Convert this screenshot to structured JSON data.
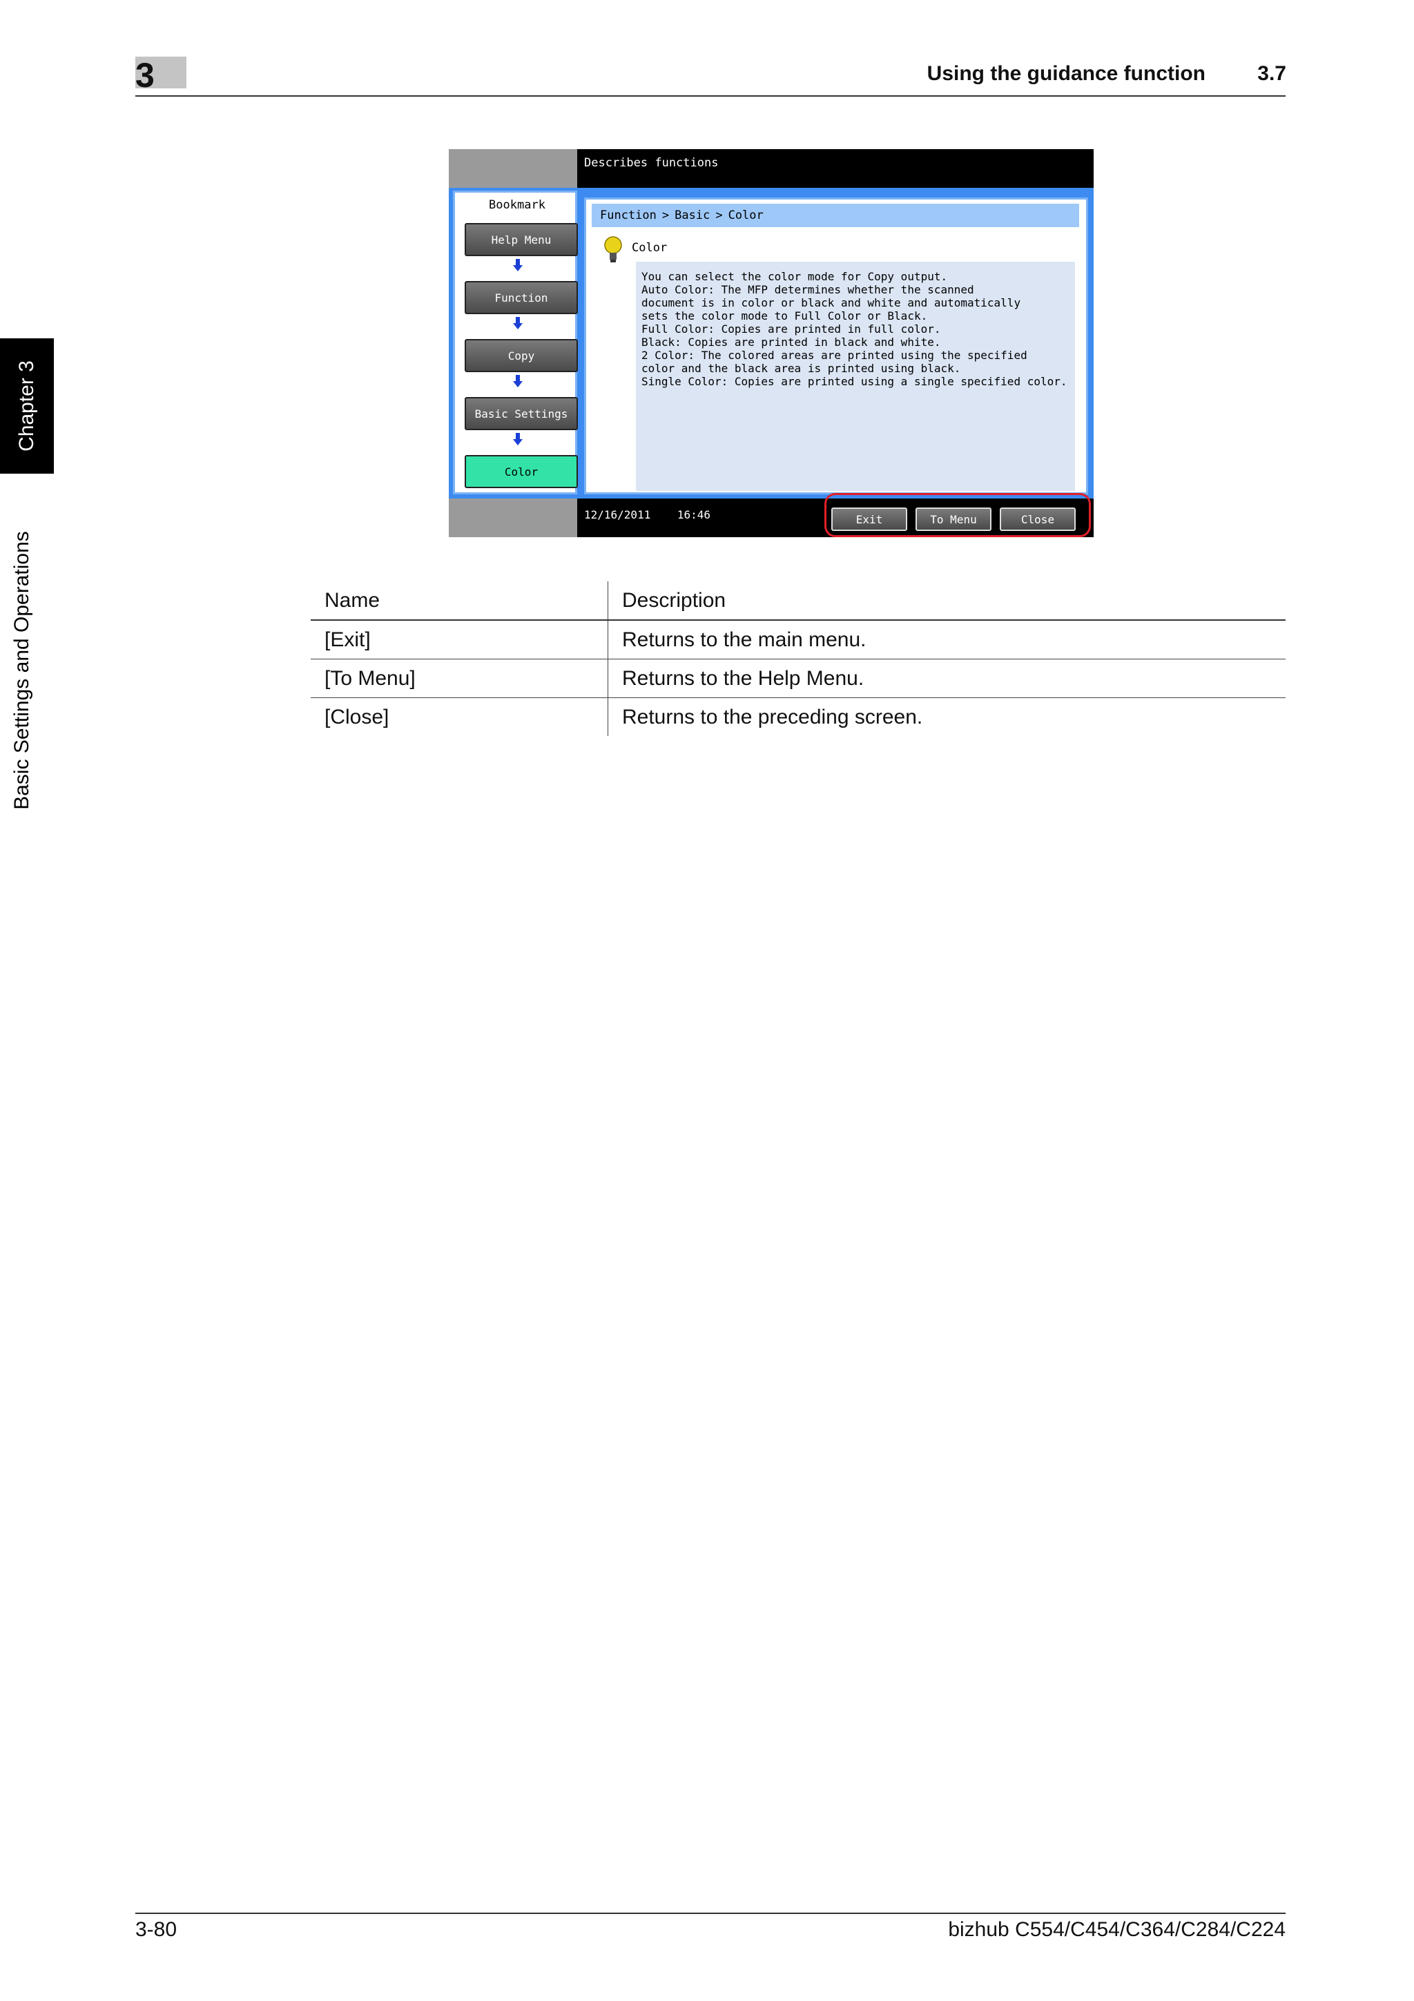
{
  "header": {
    "chapter_number": "3",
    "title": "Using the guidance function",
    "section": "3.7"
  },
  "side": {
    "chapter_tab": "Chapter 3",
    "section_tab": "Basic Settings and Operations"
  },
  "screen": {
    "top_label": "Describes functions",
    "bookmark": {
      "title": "Bookmark",
      "items": [
        "Help Menu",
        "Function",
        "Copy",
        "Basic Settings",
        "Color"
      ]
    },
    "breadcrumb": [
      "Function",
      "Basic",
      "Color"
    ],
    "help_title": "Color",
    "description": "You can select the color mode for Copy output.\nAuto Color: The MFP determines whether the scanned\ndocument is in color or black and white and automatically\nsets the color mode to Full Color or Black.\nFull Color: Copies are printed in full color.\nBlack: Copies are printed in black and white.\n2 Color: The colored areas are printed using the specified\ncolor and the black area is printed using black.\nSingle Color: Copies are printed using a single specified color.",
    "date": "12/16/2011",
    "time": "16:46",
    "buttons": [
      "Exit",
      "To Menu",
      "Close"
    ]
  },
  "table": {
    "headers": [
      "Name",
      "Description"
    ],
    "rows": [
      [
        "[Exit]",
        "Returns to the main menu."
      ],
      [
        "[To Menu]",
        "Returns to the Help Menu."
      ],
      [
        "[Close]",
        "Returns to the preceding screen."
      ]
    ]
  },
  "footer": {
    "page": "3-80",
    "product": "bizhub C554/C454/C364/C284/C224"
  },
  "colors": {
    "frame_blue": "#3d8bf0",
    "active_green": "#33e2a6",
    "highlight_red": "#e0202a"
  }
}
